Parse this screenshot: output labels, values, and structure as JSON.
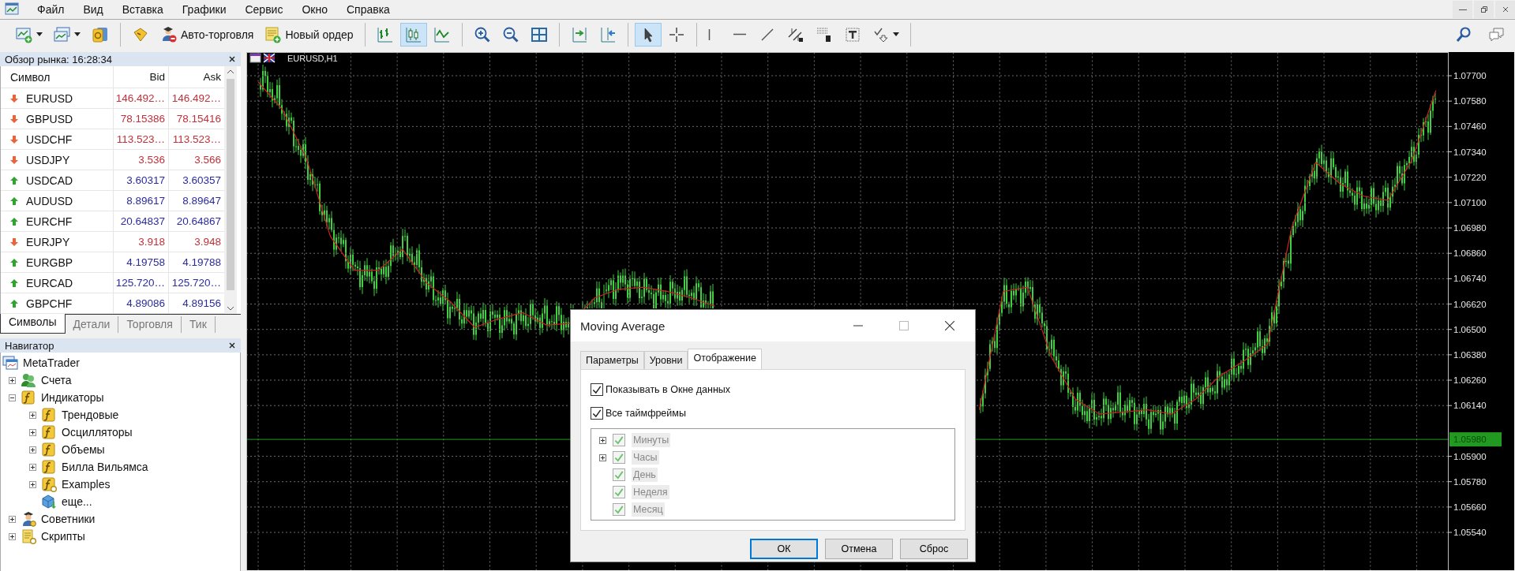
{
  "menu": [
    "Файл",
    "Вид",
    "Вставка",
    "Графики",
    "Сервис",
    "Окно",
    "Справка"
  ],
  "toolbar_groups": [
    {
      "items": [
        {
          "kind": "new-chart",
          "dropdown": true
        },
        {
          "kind": "profiles",
          "dropdown": true
        },
        {
          "kind": "market-watch"
        }
      ]
    },
    {
      "items": [
        {
          "kind": "metaeditor"
        },
        {
          "kind": "auto-trading",
          "label": "Авто-торговля"
        },
        {
          "kind": "new-order",
          "label": "Новый ордер"
        }
      ]
    },
    {
      "items": [
        {
          "kind": "bar-chart",
          "selected": false
        },
        {
          "kind": "candles",
          "selected": true
        },
        {
          "kind": "line-chart",
          "selected": false
        }
      ]
    },
    {
      "items": [
        {
          "kind": "zoom-in"
        },
        {
          "kind": "zoom-out"
        },
        {
          "kind": "tile"
        }
      ]
    },
    {
      "items": [
        {
          "kind": "chart-shift"
        },
        {
          "kind": "autoscroll"
        }
      ]
    },
    {
      "items": [
        {
          "kind": "cursor",
          "selected": true
        },
        {
          "kind": "crosshair",
          "selected": false
        }
      ]
    },
    {
      "items": [
        {
          "kind": "vline"
        },
        {
          "kind": "hline"
        },
        {
          "kind": "trendline"
        },
        {
          "kind": "channel"
        },
        {
          "kind": "fibo"
        },
        {
          "kind": "text"
        },
        {
          "kind": "arrows",
          "dropdown": true
        }
      ]
    }
  ],
  "toolbar_right": [
    {
      "kind": "search"
    },
    {
      "kind": "chat"
    }
  ],
  "market_watch": {
    "title": "Обзор рынка: 16:28:34",
    "columns": [
      "Символ",
      "Bid",
      "Ask"
    ],
    "rows": [
      {
        "symbol": "EURUSD",
        "rising": false,
        "bid": "146.492…",
        "ask": "146.492…"
      },
      {
        "symbol": "GBPUSD",
        "rising": false,
        "bid": "78.15386",
        "ask": "78.15416"
      },
      {
        "symbol": "USDCHF",
        "rising": false,
        "bid": "113.523…",
        "ask": "113.523…"
      },
      {
        "symbol": "USDJPY",
        "rising": false,
        "bid": "3.536",
        "ask": "3.566"
      },
      {
        "symbol": "USDCAD",
        "rising": true,
        "bid": "3.60317",
        "ask": "3.60357"
      },
      {
        "symbol": "AUDUSD",
        "rising": true,
        "bid": "8.89617",
        "ask": "8.89647"
      },
      {
        "symbol": "EURCHF",
        "rising": true,
        "bid": "20.64837",
        "ask": "20.64867"
      },
      {
        "symbol": "EURJPY",
        "rising": false,
        "bid": "3.918",
        "ask": "3.948"
      },
      {
        "symbol": "EURGBP",
        "rising": true,
        "bid": "4.19758",
        "ask": "4.19788"
      },
      {
        "symbol": "EURCAD",
        "rising": true,
        "bid": "125.720…",
        "ask": "125.720…"
      },
      {
        "symbol": "GBPCHF",
        "rising": true,
        "bid": "4.89086",
        "ask": "4.89156"
      }
    ],
    "tabs": [
      {
        "label": "Символы",
        "selected": true
      },
      {
        "label": "Детали",
        "selected": false
      },
      {
        "label": "Торговля",
        "selected": false
      },
      {
        "label": "Тик",
        "selected": false
      }
    ]
  },
  "navigator": {
    "title": "Навигатор",
    "tree": [
      {
        "label": "MetaTrader",
        "kind": "terminal",
        "children": [
          {
            "label": "Счета",
            "kind": "accounts",
            "expanded": false
          },
          {
            "label": "Индикаторы",
            "kind": "indicators",
            "expanded": true,
            "children": [
              {
                "label": "Трендовые",
                "kind": "indicators",
                "expanded": false
              },
              {
                "label": "Осцилляторы",
                "kind": "indicators",
                "expanded": false
              },
              {
                "label": "Объемы",
                "kind": "indicators",
                "expanded": false
              },
              {
                "label": "Билла Вильямса",
                "kind": "indicators",
                "expanded": false
              },
              {
                "label": "Examples",
                "kind": "indicator-custom",
                "expanded": false
              },
              {
                "label": "еще...",
                "kind": "market"
              }
            ]
          },
          {
            "label": "Советники",
            "kind": "experts",
            "expanded": false
          },
          {
            "label": "Скрипты",
            "kind": "scripts",
            "expanded": false
          }
        ]
      }
    ]
  },
  "chart": {
    "title": "EURUSD,H1",
    "chart_data": {
      "type": "line",
      "grid": true,
      "ylim": [
        1.0536,
        1.0781
      ],
      "ref_lines": [
        {
          "axis": "y",
          "value": 1.0598,
          "label": "1.05980",
          "color": "#229a22"
        }
      ],
      "yticks": [
        {
          "value": 1.077,
          "label": "1.07700"
        },
        {
          "value": 1.0758,
          "label": "1.07580"
        },
        {
          "value": 1.0746,
          "label": "1.07460"
        },
        {
          "value": 1.0734,
          "label": "1.07340"
        },
        {
          "value": 1.0722,
          "label": "1.07220"
        },
        {
          "value": 1.071,
          "label": "1.07100"
        },
        {
          "value": 1.0698,
          "label": "1.06980"
        },
        {
          "value": 1.0686,
          "label": "1.06860"
        },
        {
          "value": 1.0674,
          "label": "1.06740"
        },
        {
          "value": 1.0662,
          "label": "1.06620"
        },
        {
          "value": 1.065,
          "label": "1.06500"
        },
        {
          "value": 1.0638,
          "label": "1.06380"
        },
        {
          "value": 1.0626,
          "label": "1.06260"
        },
        {
          "value": 1.0614,
          "label": "1.06140"
        },
        {
          "value": 1.059,
          "label": "1.05900"
        },
        {
          "value": 1.0578,
          "label": "1.05780"
        },
        {
          "value": 1.0566,
          "label": "1.05660"
        },
        {
          "value": 1.0554,
          "label": "1.05540"
        }
      ],
      "series": [
        {
          "color": "#d02020",
          "values": [
            1.0767,
            1.0754,
            1.0731,
            1.0694,
            1.0678,
            1.0678,
            1.0688,
            1.0672,
            1.0663,
            1.0651,
            1.0655,
            1.0658,
            1.0652,
            1.0653,
            1.0665,
            1.0669,
            1.067,
            1.0668,
            1.0665,
            1.0661,
            null,
            null,
            null,
            null,
            null,
            null,
            null,
            null,
            null,
            null,
            1.0612,
            1.0668,
            1.067,
            1.0637,
            1.0617,
            1.061,
            1.0611,
            1.0612,
            1.061,
            1.0617,
            1.0628,
            1.0635,
            1.0643,
            1.0698,
            1.0729,
            1.0719,
            1.0713,
            1.0711,
            1.073,
            1.0763
          ]
        }
      ]
    }
  },
  "dialog": {
    "title": "Moving Average",
    "tabs": [
      {
        "label": "Параметры",
        "selected": false
      },
      {
        "label": "Уровни",
        "selected": false
      },
      {
        "label": "Отображение",
        "selected": true
      }
    ],
    "options": [
      {
        "label": "Показывать в Окне данных",
        "checked": true
      },
      {
        "label": "Все таймфреймы",
        "checked": true
      }
    ],
    "timeframes": [
      {
        "label": "Минуты",
        "expanded": false,
        "checked": true,
        "disabled": true
      },
      {
        "label": "Часы",
        "expanded": false,
        "checked": true,
        "disabled": true
      },
      {
        "label": "День",
        "checked": true,
        "disabled": true
      },
      {
        "label": "Неделя",
        "checked": true,
        "disabled": true
      },
      {
        "label": "Месяц",
        "checked": true,
        "disabled": true
      }
    ],
    "buttons": [
      {
        "label": "ОК",
        "default": true
      },
      {
        "label": "Отмена",
        "default": false
      },
      {
        "label": "Сброс",
        "default": false
      }
    ]
  }
}
